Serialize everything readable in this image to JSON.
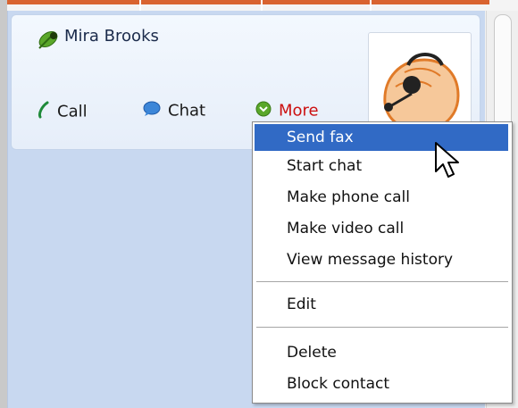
{
  "contact": {
    "name": "Mira Brooks"
  },
  "actions": {
    "call": "Call",
    "chat": "Chat",
    "more": "More"
  },
  "menu": {
    "items": [
      {
        "label": "Send fax",
        "active": true
      },
      {
        "label": "Start chat"
      },
      {
        "label": "Make phone call"
      },
      {
        "label": "Make video call"
      },
      {
        "label": "View message history"
      },
      {
        "label": "Edit"
      },
      {
        "label": "Delete"
      },
      {
        "label": "Block contact"
      }
    ]
  },
  "colors": {
    "accent": "#d9632f",
    "menu_highlight": "#316ac5",
    "more_link": "#cc1111"
  },
  "icons": {
    "status": "status-leaf-icon",
    "call": "phone-icon",
    "chat": "chat-bubble-icon",
    "more": "chevron-down-icon"
  }
}
